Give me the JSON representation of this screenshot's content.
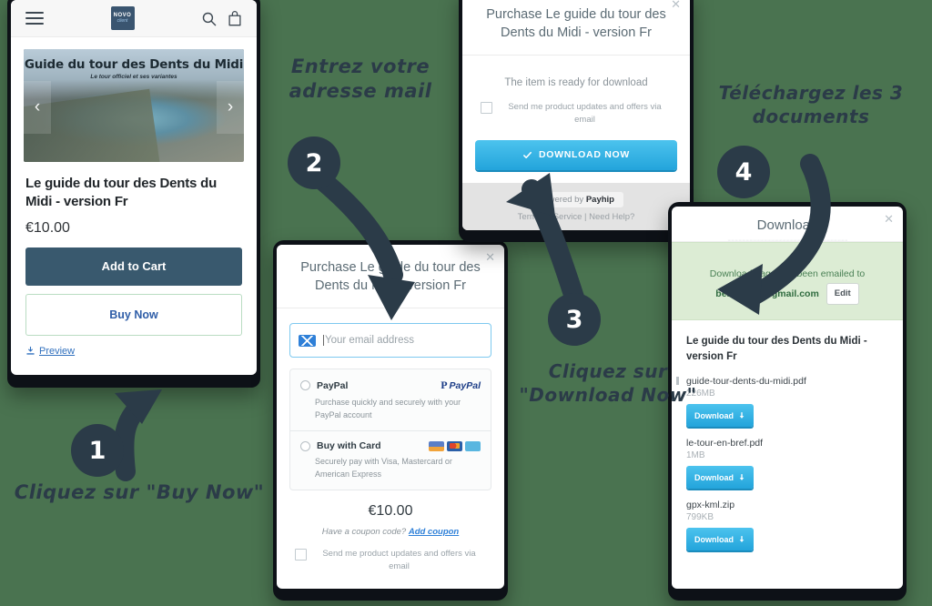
{
  "background_color": "#4a7350",
  "panel1": {
    "name": "shop-product-page",
    "header": {
      "menu_icon": "hamburger-icon",
      "logo_main": "NOVO",
      "logo_sub": "client",
      "search_icon": "search-icon",
      "cart_icon": "bag-icon"
    },
    "hero": {
      "title": "Guide du tour des Dents du Midi",
      "subtitle": "Le tour officiel et ses variantes",
      "prev_icon": "chevron-left-icon",
      "next_icon": "chevron-right-icon"
    },
    "product_title": "Le guide du tour des Dents du Midi - version Fr",
    "price": "€10.00",
    "add_to_cart": "Add to Cart",
    "buy_now": "Buy Now",
    "preview": "Preview",
    "colors": {
      "add_to_cart_bg": "#39596e",
      "buy_now_text": "#2f5ea8",
      "buy_now_border": "#b9dcc2"
    }
  },
  "panel2": {
    "name": "purchase-modal",
    "title": "Purchase Le guide du tour des Dents du Midi - version Fr",
    "close_icon": "close-icon",
    "email_placeholder": "Your email address",
    "email_value": "",
    "payment_options": [
      {
        "name": "PayPal",
        "description": "Purchase quickly and securely with your PayPal account",
        "brand": "PayPal",
        "selected": false
      },
      {
        "name": "Buy with Card",
        "description": "Securely pay with Visa, Mastercard or American Express",
        "brand": "visa-mastercard-amex",
        "selected": false
      }
    ],
    "price": "€10.00",
    "coupon_text": "Have a coupon code?",
    "coupon_link": "Add coupon",
    "optin_label": "Send me product updates and offers via email",
    "optin_checked": false
  },
  "panel3": {
    "name": "ready-for-download-modal",
    "title": "Purchase Le guide du tour des Dents du Midi - version Fr",
    "close_icon": "close-icon",
    "message": "The item is ready for download",
    "optin_label": "Send me product updates and offers via email",
    "optin_checked": false,
    "download_button": "DOWNLOAD NOW",
    "download_button_icon": "check-icon",
    "footer_powered_prefix": "Powered by",
    "footer_powered_brand": "Payhip",
    "footer_links": "Terms of Service  |  Need Help?"
  },
  "panel4": {
    "name": "download-modal",
    "title": "Download",
    "close_icon": "close-icon",
    "notice_line1": "Download page has been emailed to",
    "notice_email": "ben...uis...@gmail.com",
    "edit_button": "Edit",
    "product_title": "Le guide du tour des Dents du Midi - version Fr",
    "files": [
      {
        "name": "guide-tour-dents-du-midi.pdf",
        "size": "226MB",
        "button": "Download"
      },
      {
        "name": "le-tour-en-bref.pdf",
        "size": "1MB",
        "button": "Download"
      },
      {
        "name": "gpx-kml.zip",
        "size": "799KB",
        "button": "Download"
      }
    ],
    "button_icon": "download-arrow-icon"
  },
  "annotations": {
    "steps": [
      {
        "number": "1",
        "caption": "Cliquez sur \"Buy Now\""
      },
      {
        "number": "2",
        "caption": "Entrez votre\nadresse mail"
      },
      {
        "number": "3",
        "caption": "Cliquez sur\n\"Download Now\""
      },
      {
        "number": "4",
        "caption": "Téléchargez les 3\ndocuments"
      }
    ],
    "caption1": "Cliquez sur \"Buy Now\"",
    "caption2_l1": "Entrez votre",
    "caption2_l2": "adresse mail",
    "caption3_l1": "Cliquez sur",
    "caption3_l2": "\"Download Now\"",
    "caption4_l1": "Téléchargez les 3",
    "caption4_l2": "documents",
    "ink_color": "#2b3b48"
  }
}
